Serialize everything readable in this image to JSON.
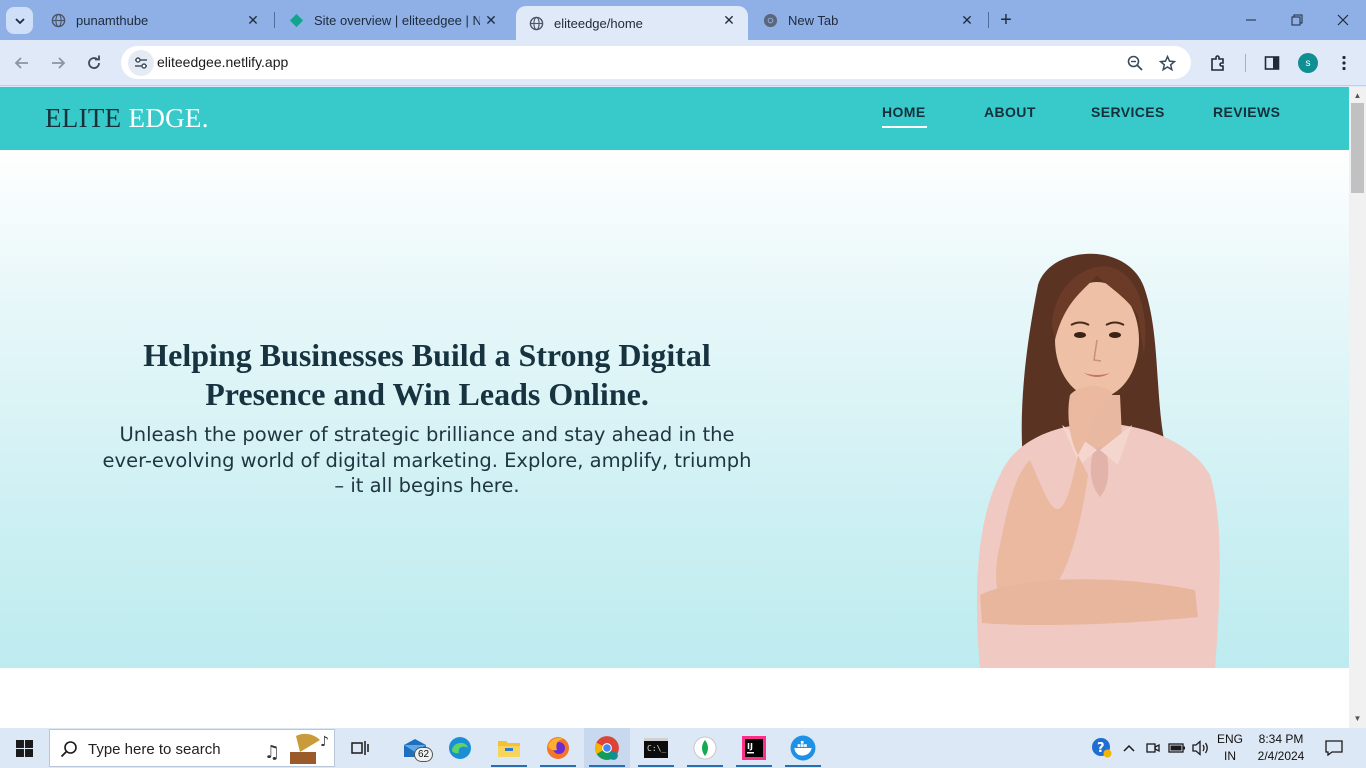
{
  "browser": {
    "tabs": [
      {
        "title": "punamthube",
        "favicon": "globe-icon",
        "active": false
      },
      {
        "title": "Site overview | eliteedgee | Netlify",
        "favicon": "netlify-diamond-icon",
        "active": false
      },
      {
        "title": "eliteedge/home",
        "favicon": "globe-icon",
        "active": true
      },
      {
        "title": "New Tab",
        "favicon": "chrome-icon",
        "active": false
      }
    ],
    "address": "eliteedgee.netlify.app",
    "profile_initial": "s",
    "accent": "#8eb0e7"
  },
  "site": {
    "logo_part1": "ELITE",
    "logo_part2": "EDGE.",
    "nav": [
      "HOME",
      "ABOUT",
      "SERVICES",
      "REVIEWS"
    ],
    "active_nav": "HOME",
    "header_color": "#38cacb",
    "hero": {
      "title": "Helping Businesses Build a Strong Digital Presence and Win Leads Online.",
      "subtitle": "Unleash the power of strategic brilliance and stay ahead in the ever-evolving world of digital marketing. Explore, amplify, triumph – it all begins here."
    }
  },
  "taskbar": {
    "search_placeholder": "Type here to search",
    "mail_badge": "62",
    "lang_line1": "ENG",
    "lang_line2": "IN",
    "time": "8:34 PM",
    "date": "2/4/2024"
  }
}
